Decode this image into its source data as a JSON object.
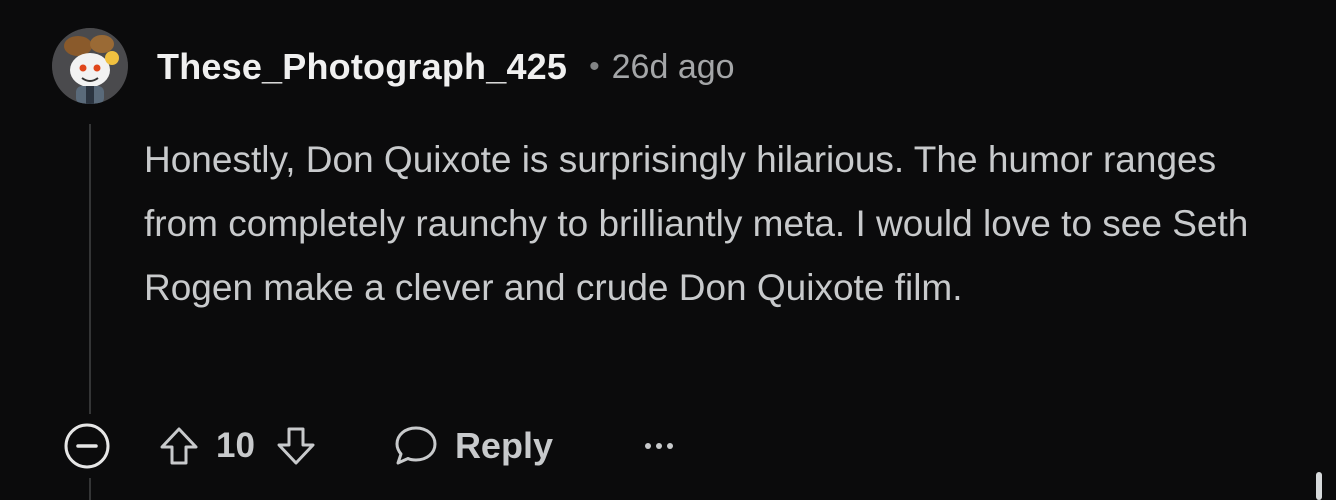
{
  "comment": {
    "author": "These_Photograph_425",
    "separator": "•",
    "timestamp": "26d ago",
    "body": "Honestly, Don Quixote is surprisingly hilarious. The humor ranges from completely raunchy to brilliantly meta. I would love to see Seth Rogen make a clever and crude Don Quixote film.",
    "score": "10",
    "reply_label": "Reply"
  },
  "icons": {
    "avatar": "snoo-avatar",
    "collapse": "minus-circle-icon",
    "upvote": "arrow-up-icon",
    "downvote": "arrow-down-icon",
    "reply": "speech-bubble-icon",
    "more": "ellipsis-icon"
  },
  "colors": {
    "background": "#0b0b0c",
    "username": "#f0f0f0",
    "text": "#c8cacc",
    "muted": "#a4a6a8",
    "thread_line": "#343536"
  }
}
